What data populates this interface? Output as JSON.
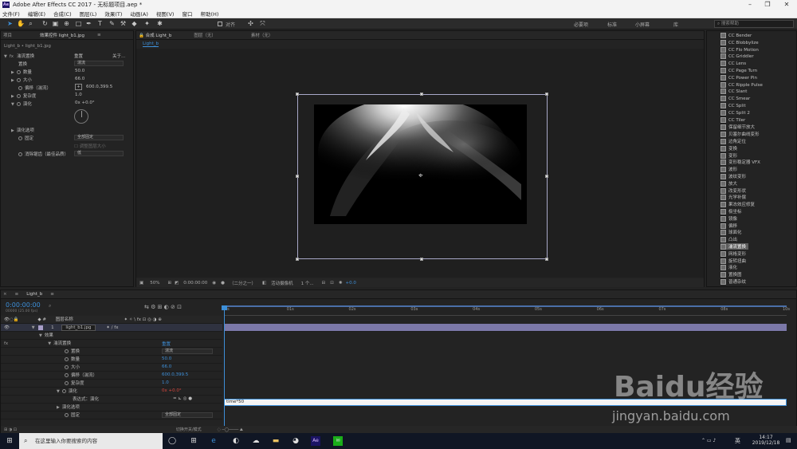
{
  "window": {
    "title": "Adobe After Effects CC 2017 - 无标题项目.aep *",
    "logo": "Ae"
  },
  "menu": [
    "文件(F)",
    "编辑(E)",
    "合成(C)",
    "图层(L)",
    "效果(T)",
    "动画(A)",
    "视图(V)",
    "窗口",
    "帮助(H)"
  ],
  "toolbar": {
    "align_label": "对齐",
    "workspaces": [
      "必要项",
      "标准",
      "小屏幕",
      "库"
    ],
    "search_placeholder": "搜索帮助"
  },
  "left_panel": {
    "tabs": [
      "项目",
      "效果控件 light_b1.jpg"
    ],
    "breadcrumb": "Light_b • light_b1.jpg",
    "effect_name": "湍流置换",
    "reset": "重置",
    "about": "关于...",
    "props": [
      {
        "label": "置换",
        "value": "湍流"
      },
      {
        "label": "数量",
        "value": "50.0"
      },
      {
        "label": "大小",
        "value": "66.0"
      },
      {
        "label": "偏移（湍流）",
        "value": "600.0,399.5"
      },
      {
        "label": "复杂度",
        "value": "1.0"
      },
      {
        "label": "演化",
        "value": "0x +0.0°"
      }
    ],
    "evolution_options": "演化选项",
    "pin": {
      "label": "固定",
      "value": "全部固定"
    },
    "resize_label": "调整图层大小",
    "antialias": {
      "label": "消除锯齿（最佳品质）",
      "value": "低"
    }
  },
  "comp_panel": {
    "tabs": [
      "合成 Light_b",
      "图层（无）",
      "素材（无）"
    ],
    "subtab": "Light_b",
    "zoom": "50%",
    "timecode": "0:00:00:00",
    "resolution": "（二分之一）",
    "camera": "活动摄像机",
    "views": "1 个...",
    "exposure": "+0.0"
  },
  "effects_list": {
    "items": [
      "CC Bender",
      "CC Blobbylize",
      "CC Flo Motion",
      "CC Griddler",
      "CC Lens",
      "CC Page Turn",
      "CC Power Pin",
      "CC Ripple Pulse",
      "CC Slant",
      "CC Smear",
      "CC Split",
      "CC Split 2",
      "CC Tiler",
      "保留细节放大",
      "贝塞尔曲线变形",
      "边角定位",
      "变换",
      "变形",
      "变形稳定器 VFX",
      "波形",
      "波纹变形",
      "放大",
      "改变形状",
      "光学补偿",
      "果冻效应修复",
      "极坐标",
      "镜像",
      "偏移",
      "球面化",
      "凸出",
      "湍流置换",
      "网格变形",
      "旋转扭曲",
      "液化",
      "置换图",
      "普通杂纹"
    ],
    "selected": "湍流置换"
  },
  "timeline": {
    "tab": "Light_b",
    "timecode": "0:00:00:00",
    "fps_note": "00000 (25.00 fps)",
    "col_header": "图层名称",
    "layer": {
      "num": "1",
      "name": "light_b1.jpg"
    },
    "effects_label": "效果",
    "effect_name": "湍流置换",
    "reset": "重置",
    "props": [
      {
        "label": "置换",
        "value": "湍流"
      },
      {
        "label": "数量",
        "value": "50.0"
      },
      {
        "label": "大小",
        "value": "66.0"
      },
      {
        "label": "偏移（湍流）",
        "value": "600.0,399.5"
      },
      {
        "label": "复杂度",
        "value": "1.0"
      },
      {
        "label": "演化",
        "value": "0x +0.0°"
      }
    ],
    "expression_label": "表达式：演化",
    "expression_text": "time*50",
    "evo_options": "演化选项",
    "pin": {
      "label": "固定",
      "value": "全部固定"
    },
    "toggle_label": "切换开关/模式",
    "ruler": [
      "0s",
      "01s",
      "02s",
      "03s",
      "04s",
      "05s",
      "06s",
      "07s",
      "08s",
      "10s"
    ]
  },
  "taskbar": {
    "search_placeholder": "在这里输入你要搜索的内容",
    "time": "14:17",
    "date": "2019/12/18",
    "ime": "英"
  },
  "watermark": {
    "brand": "Baidu经验",
    "url": "jingyan.baidu.com"
  }
}
